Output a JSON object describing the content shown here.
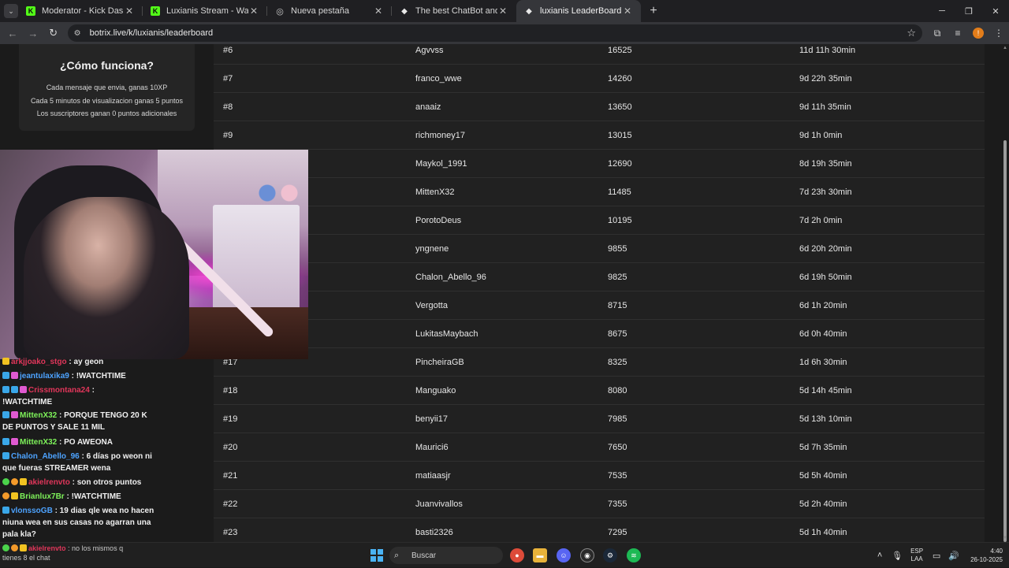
{
  "browser": {
    "tabs": [
      {
        "title": "Moderator - Kick Dashboard",
        "icon": "kick-icon",
        "active": false
      },
      {
        "title": "Luxianis Stream - Watch Live on Kick",
        "icon": "kick-icon",
        "active": false
      },
      {
        "title": "Nueva pestaña",
        "icon": "chrome-icon",
        "active": false
      },
      {
        "title": "The best ChatBot and Widgets",
        "icon": "botrix-icon",
        "active": false
      },
      {
        "title": "luxianis LeaderBoard | The best",
        "icon": "botrix-icon",
        "active": true
      }
    ],
    "new_tab": "+",
    "url": "botrix.live/k/luxianis/leaderboard",
    "profile_initial": "!"
  },
  "info_card": {
    "title": "¿Cómo funciona?",
    "lines": [
      "Cada mensaje que envia, ganas 10XP",
      "Cada 5 minutos de visualizacion ganas 5 puntos",
      "Los suscriptores ganan 0 puntos adicionales"
    ]
  },
  "leaderboard": {
    "rows": [
      {
        "rank": "#6",
        "name": "Agvvss",
        "points": "16525",
        "watchtime": "11d 11h 30min"
      },
      {
        "rank": "#7",
        "name": "franco_wwe",
        "points": "14260",
        "watchtime": "9d 22h 35min"
      },
      {
        "rank": "#8",
        "name": "anaaiz",
        "points": "13650",
        "watchtime": "9d 11h 35min"
      },
      {
        "rank": "#9",
        "name": "richmoney17",
        "points": "13015",
        "watchtime": "9d 1h 0min"
      },
      {
        "rank": "",
        "name": "Maykol_1991",
        "points": "12690",
        "watchtime": "8d 19h 35min"
      },
      {
        "rank": "",
        "name": "MittenX32",
        "points": "11485",
        "watchtime": "7d 23h 30min"
      },
      {
        "rank": "",
        "name": "PorotoDeus",
        "points": "10195",
        "watchtime": "7d 2h 0min"
      },
      {
        "rank": "",
        "name": "yngnene",
        "points": "9855",
        "watchtime": "6d 20h 20min"
      },
      {
        "rank": "",
        "name": "Chalon_Abello_96",
        "points": "9825",
        "watchtime": "6d 19h 50min"
      },
      {
        "rank": "",
        "name": "Vergotta",
        "points": "8715",
        "watchtime": "6d 1h 20min"
      },
      {
        "rank": "",
        "name": "LukitasMaybach",
        "points": "8675",
        "watchtime": "6d 0h 40min"
      },
      {
        "rank": "#17",
        "name": "PincheiraGB",
        "points": "8325",
        "watchtime": "1d 6h 30min"
      },
      {
        "rank": "#18",
        "name": "Manguako",
        "points": "8080",
        "watchtime": "5d 14h 45min"
      },
      {
        "rank": "#19",
        "name": "benyii17",
        "points": "7985",
        "watchtime": "5d 13h 10min"
      },
      {
        "rank": "#20",
        "name": "Maurici6",
        "points": "7650",
        "watchtime": "5d 7h 35min"
      },
      {
        "rank": "#21",
        "name": "matiaasjr",
        "points": "7535",
        "watchtime": "5d 5h 40min"
      },
      {
        "rank": "#22",
        "name": "Juanvivallos",
        "points": "7355",
        "watchtime": "5d 2h 40min"
      },
      {
        "rank": "#23",
        "name": "basti2326",
        "points": "7295",
        "watchtime": "5d 1h 40min"
      }
    ]
  },
  "chat": {
    "messages": [
      {
        "user": "arkjjoako_stgo",
        "color": "#e0365a",
        "text": ": ay geon",
        "badges": [
          "b-yellow"
        ]
      },
      {
        "user": "jeantulaxika9",
        "color": "#4da3ff",
        "text": ": !WATCHTIME",
        "badges": [
          "b-blue",
          "b-pink"
        ]
      },
      {
        "user": "Crissmontana24",
        "color": "#e0365a",
        "text": ":",
        "badges": [
          "b-blue",
          "b-blue",
          "b-pink"
        ]
      },
      {
        "user": "",
        "color": "#ffffff",
        "text": "!WATCHTIME",
        "badges": []
      },
      {
        "user": "MittenX32",
        "color": "#7ef25a",
        "text": ": PORQUE TENGO 20 K DE PUNTOS Y SALE 11 MIL",
        "badges": [
          "b-blue",
          "b-pink"
        ]
      },
      {
        "user": "MittenX32",
        "color": "#7ef25a",
        "text": ": PO AWEONA",
        "badges": [
          "b-blue",
          "b-pink"
        ]
      },
      {
        "user": "Chalon_Abello_96",
        "color": "#4da3ff",
        "text": ": 6 días po weon ni que fueras STREAMER wena",
        "badges": [
          "b-blue"
        ]
      },
      {
        "user": "akielrenvto",
        "color": "#e0365a",
        "text": ": son otros puntos",
        "badges": [
          "b-green",
          "b-orange",
          "b-yellow"
        ]
      },
      {
        "user": "Brianlux7Br",
        "color": "#7ef25a",
        "text": ": !WATCHTIME",
        "badges": [
          "b-orange",
          "b-yellow"
        ]
      },
      {
        "user": "vlonssoGB",
        "color": "#4da3ff",
        "text": ": 19 dias qle wea no hacen niuna wea en sus casas no agarran una pala kla?",
        "badges": [
          "b-blue"
        ]
      },
      {
        "user": "akielrenvto",
        "color": "#e0365a",
        "text": ": no los mismos q",
        "badges": [
          "b-green",
          "b-orange",
          "b-yellow"
        ]
      }
    ],
    "overflow_hint": "tienes 8 el chat"
  },
  "taskbar": {
    "search_placeholder": "Buscar",
    "lang_top": "ESP",
    "lang_bottom": "LAA",
    "time": "4:40",
    "date": "26-10-2025"
  },
  "colors": {
    "kick_green": "#53fc18",
    "board_bg": "#212121",
    "page_bg": "#1b1b1b"
  }
}
